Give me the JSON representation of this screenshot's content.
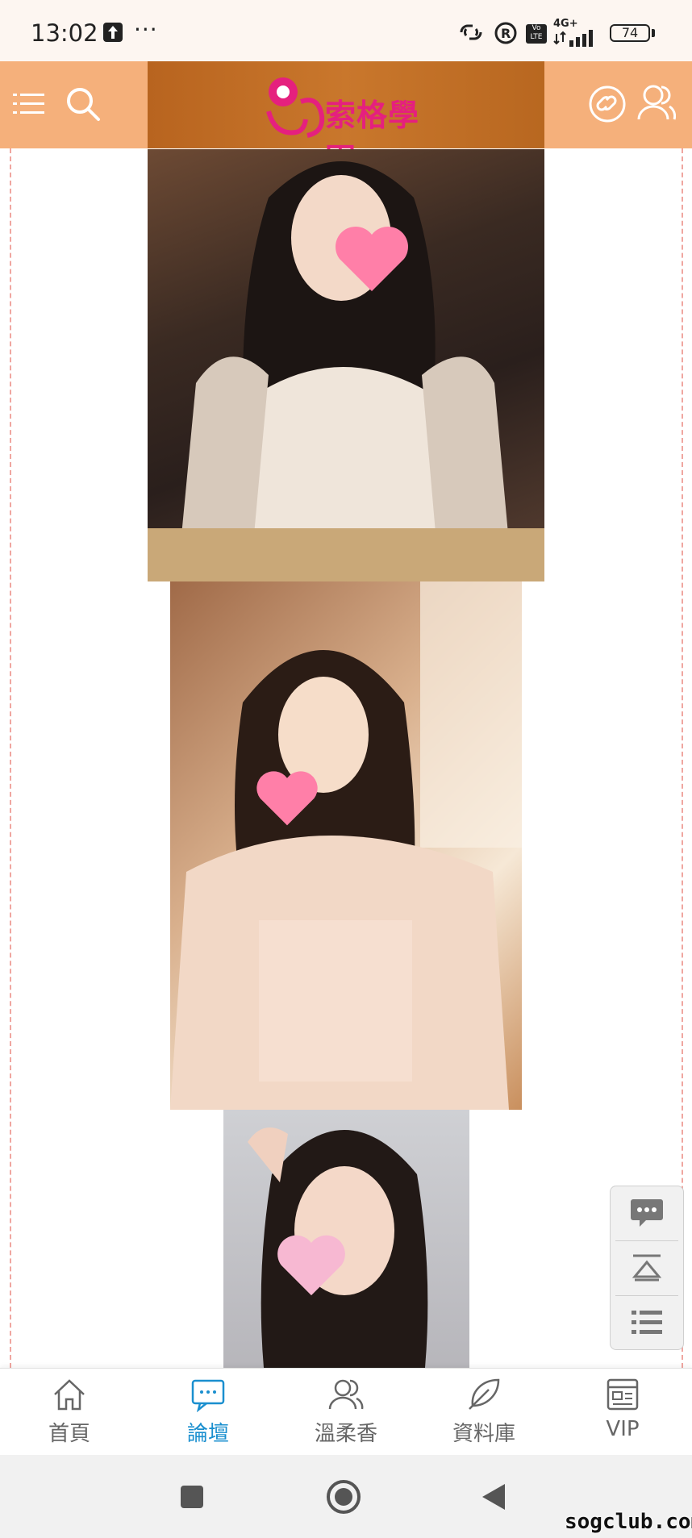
{
  "status_bar": {
    "time": "13:02",
    "dots": "···",
    "network": "4G+",
    "volte": "Vo LTE",
    "battery": "74"
  },
  "header": {
    "logo_text": "索格學園",
    "icons": [
      "menu-icon",
      "search-icon",
      "link-icon",
      "user-icon"
    ]
  },
  "content": {
    "photos": [
      "photo-1",
      "photo-2",
      "photo-3"
    ]
  },
  "floating_tools": [
    "chat-icon",
    "scroll-top-icon",
    "list-icon"
  ],
  "bottom_nav": {
    "items": [
      {
        "label": "首頁",
        "icon": "home-icon",
        "active": false
      },
      {
        "label": "論壇",
        "icon": "forum-icon",
        "active": true
      },
      {
        "label": "溫柔香",
        "icon": "users-icon",
        "active": false
      },
      {
        "label": "資料庫",
        "icon": "feather-icon",
        "active": false
      },
      {
        "label": "VIP",
        "icon": "vip-icon",
        "active": false
      }
    ],
    "active_color": "#1a8fcf"
  },
  "system_nav": [
    "recent-apps-icon",
    "home-circle-icon",
    "back-icon"
  ],
  "watermark": "sogclub.com",
  "colors": {
    "header": "#f5b07b",
    "header_center": "#c9772c",
    "brand_pink": "#e5207e"
  }
}
